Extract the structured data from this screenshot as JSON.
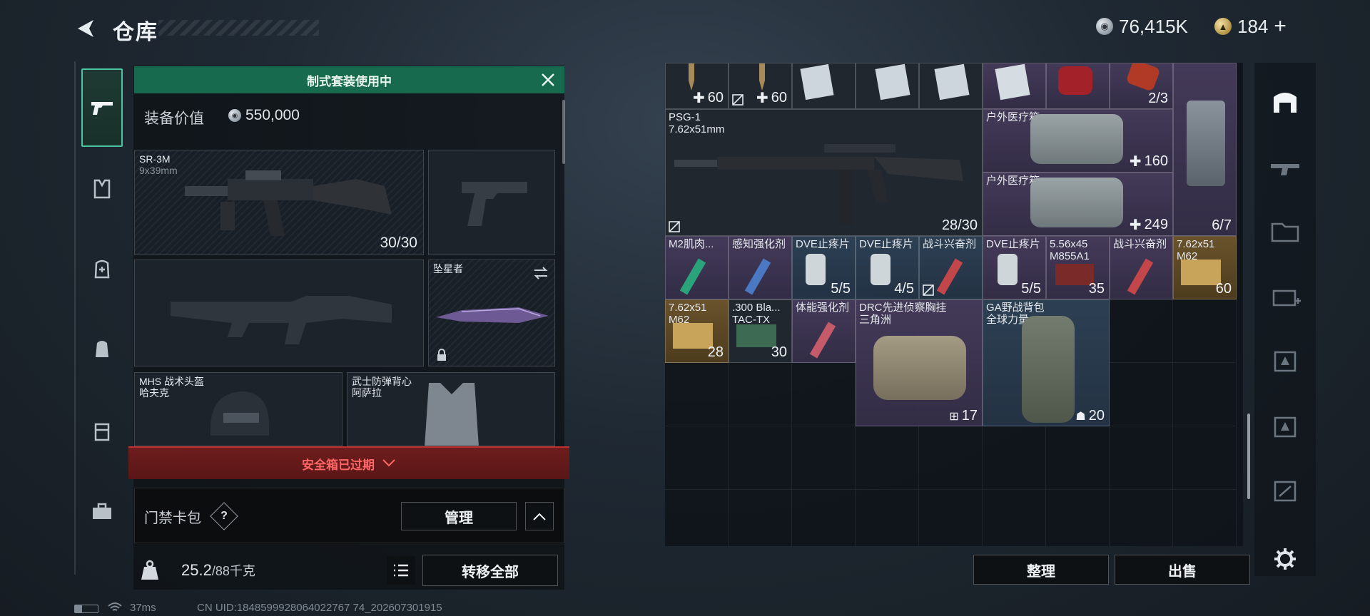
{
  "header": {
    "title": "仓库",
    "currency_silver": "76,415K",
    "currency_gold": "184",
    "add_symbol": "+"
  },
  "equipment": {
    "banner": "制式套装使用中",
    "value_label": "装备价值",
    "value_amount": "550,000",
    "primary": {
      "name": "SR-3M",
      "caliber": "9x39mm",
      "ammo": "30/30"
    },
    "melee": {
      "name": "坠星者"
    },
    "helmet": {
      "name": "MHS 战术头盔",
      "map": "哈夫克"
    },
    "armor": {
      "name": "武士防弹背心",
      "map": "阿萨拉"
    },
    "safebox_text": "安全箱已过期",
    "access_label": "门禁卡包",
    "access_help": "?",
    "manage_button": "管理",
    "weight_current": "25.2",
    "weight_max": "/88千克",
    "transfer_all_button": "转移全部"
  },
  "status_bar": {
    "ping": "37ms",
    "uid": "CN UID:1848599928064022767 74_202607301915"
  },
  "warehouse": {
    "top_row": [
      {
        "qty": "60"
      },
      {
        "qty": "60"
      },
      {
        "qty": ""
      },
      {
        "qty": ""
      },
      {
        "qty": ""
      },
      {
        "qty": ""
      },
      {
        "qty": ""
      },
      {
        "qty": "2/3"
      }
    ],
    "psg": {
      "name": "PSG-1",
      "caliber": "7.62x51mm",
      "ammo": "28/30"
    },
    "medkit1": {
      "name": "户外医疗箱",
      "qty": "160"
    },
    "medkit2": {
      "name": "户外医疗箱",
      "qty": "249"
    },
    "case_qty": "6/7",
    "row3": [
      {
        "name": "M2肌肉...",
        "qty": ""
      },
      {
        "name": "感知强化剂",
        "qty": ""
      },
      {
        "name": "DVE止疼片",
        "qty": "5/5"
      },
      {
        "name": "DVE止疼片",
        "qty": "4/5"
      },
      {
        "name": "战斗兴奋剂",
        "qty": ""
      },
      {
        "name": "DVE止疼片",
        "qty": "5/5"
      },
      {
        "name": "5.56x45",
        "name2": "M855A1",
        "qty": "35"
      },
      {
        "name": "战斗兴奋剂",
        "qty": ""
      },
      {
        "name": "7.62x51",
        "name2": "M62",
        "qty": "60"
      }
    ],
    "row4": [
      {
        "name": "7.62x51",
        "name2": "M62",
        "qty": "28"
      },
      {
        "name": ".300 Bla...",
        "name2": "TAC-TX",
        "qty": "30"
      },
      {
        "name": "体能强化剂",
        "qty": ""
      }
    ],
    "vest": {
      "name": "DRC先进侦察胸挂",
      "map": "三角洲",
      "qty": "17"
    },
    "backpack": {
      "name": "GA野战背包",
      "map": "全球力量",
      "qty": "20"
    },
    "sort_button": "整理",
    "sell_button": "出售"
  }
}
